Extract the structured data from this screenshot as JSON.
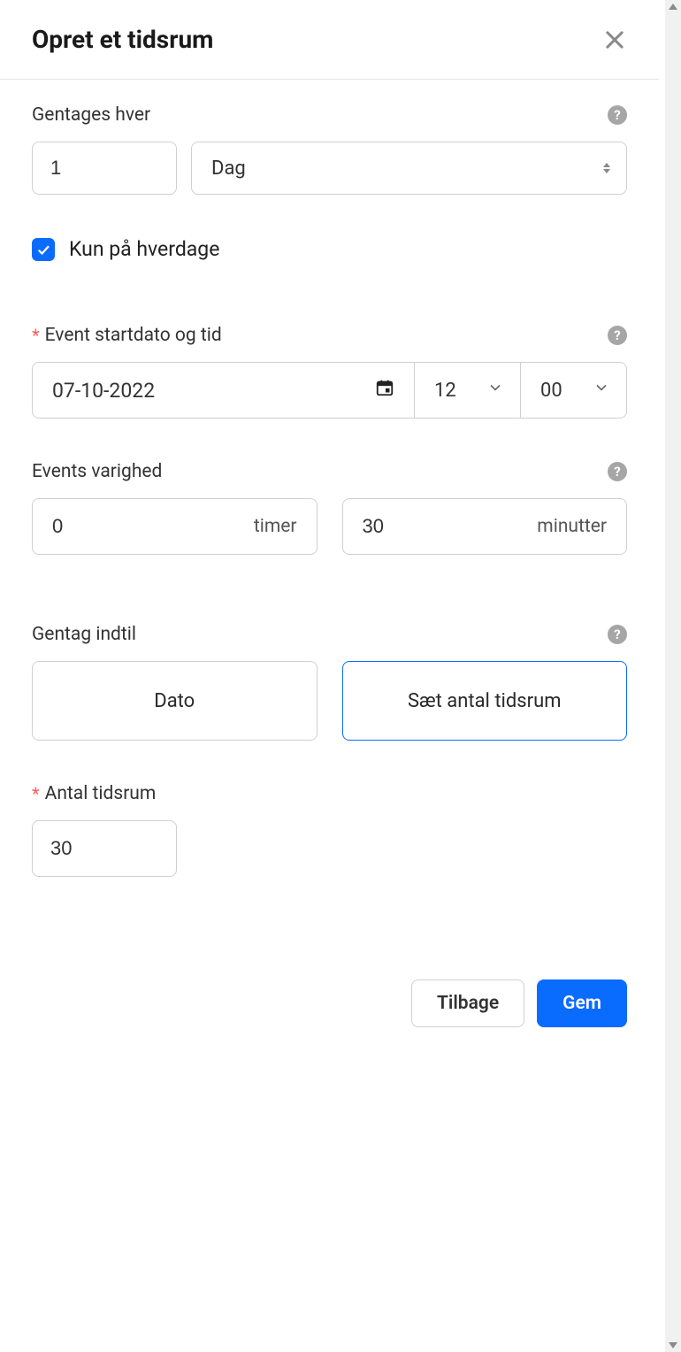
{
  "header": {
    "title": "Opret et tidsrum"
  },
  "repeat": {
    "label": "Gentages hver",
    "interval_value": "1",
    "unit_selected": "Dag"
  },
  "weekdays_only": {
    "label": "Kun på hverdage",
    "checked": true
  },
  "start": {
    "label": "Event startdato og tid",
    "date_value": "07-10-2022",
    "hour_value": "12",
    "minute_value": "00"
  },
  "duration": {
    "label": "Events varighed",
    "hours_value": "0",
    "hours_suffix": "timer",
    "minutes_value": "30",
    "minutes_suffix": "minutter"
  },
  "repeat_until": {
    "label": "Gentag indtil",
    "options": {
      "date": "Dato",
      "count": "Sæt antal tidsrum"
    },
    "selected": "count"
  },
  "count": {
    "label": "Antal tidsrum",
    "value": "30"
  },
  "footer": {
    "back": "Tilbage",
    "save": "Gem"
  }
}
